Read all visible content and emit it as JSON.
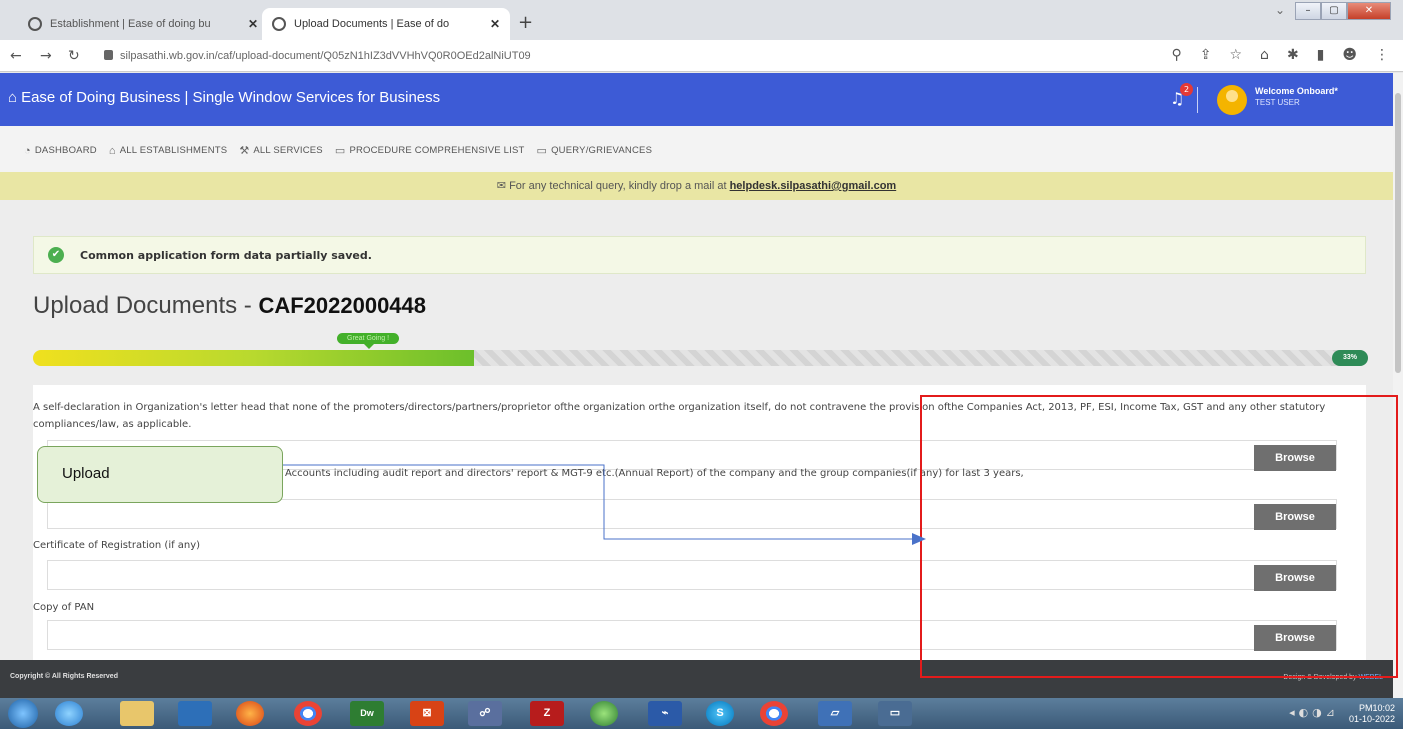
{
  "browser": {
    "tabs": [
      {
        "title": "Establishment | Ease of doing bu",
        "active": false
      },
      {
        "title": "Upload Documents | Ease of do",
        "active": true
      }
    ],
    "url": "silpasathi.wb.gov.in/caf/upload-document/Q05zN1hIZ3dVVHhVQ0R0OEd2alNiUT09",
    "new_tab": "+"
  },
  "app": {
    "title": "Ease of Doing Business | Single Window Services for Business",
    "notification_count": "2",
    "welcome": "Welcome Onboard*",
    "user": "TEST USER"
  },
  "menu": [
    {
      "label": "DASHBOARD",
      "icon": "dashboard-icon"
    },
    {
      "label": "ALL ESTABLISHMENTS",
      "icon": "building-icon"
    },
    {
      "label": "ALL SERVICES",
      "icon": "wrench-icon"
    },
    {
      "label": "PROCEDURE COMPREHENSIVE LIST",
      "icon": "list-icon"
    },
    {
      "label": "QUERY/GRIEVANCES",
      "icon": "chat-icon"
    }
  ],
  "notice": {
    "text": "For any technical query, kindly drop a mail at ",
    "email": "helpdesk.silpasathi@gmail.com"
  },
  "alert": "Common application form data partially saved.",
  "page": {
    "title": "Upload Documents - ",
    "caf": "CAF2022000448",
    "progress_label": "Great Going !",
    "progress_percent": "33%",
    "progress_value": 0.33
  },
  "documents": [
    {
      "label": "A self-declaration in Organization's letter head that none of the promoters/directors/partners/proprietor ofthe organization orthe organization itself, do not contravene the provision ofthe Companies Act, 2013, PF, ESI, Income Tax, GST and any other statutory compliances/law, as applicable.",
      "button": "Browse"
    },
    {
      "label": "Accounts including audit report and directors' report & MGT-9 etc.(Annual Report) of the company and the group companies(if any) for last 3 years,",
      "button": "Browse"
    },
    {
      "label": "Certificate of Registration (if any)",
      "button": "Browse"
    },
    {
      "label": "Copy of PAN",
      "button": "Browse"
    }
  ],
  "footer": {
    "left": "Copyright © All Rights Reserved",
    "right": "Design & Developed by ",
    "right_link": "WEBEL"
  },
  "taskbar": {
    "clock_time": "PM10:02",
    "clock_date": "01-10-2022"
  },
  "annotation": {
    "callout": "Upload"
  },
  "colors": {
    "header": "#3d5bd6",
    "notice": "#e9e6a4",
    "browse_button": "#6f6f6f",
    "highlight": "#e31b1b"
  }
}
